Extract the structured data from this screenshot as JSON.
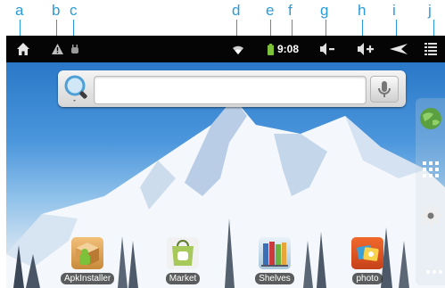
{
  "callouts": [
    "a",
    "b",
    "c",
    "d",
    "e",
    "f",
    "g",
    "h",
    "i",
    "j"
  ],
  "status_bar": {
    "time": "9:08",
    "icons": [
      "home-icon",
      "warning-icon",
      "usb-debug-icon",
      "wifi-icon",
      "battery-icon",
      "volume-down-icon",
      "volume-up-icon",
      "back-icon",
      "menu-icon"
    ]
  },
  "search": {
    "placeholder": ""
  },
  "side_panel": {
    "icons": [
      "browser-globe-icon",
      "app-drawer-grid-icon",
      "settings-gear-icon",
      "more-dots-icon"
    ]
  },
  "apps": [
    {
      "label": "ApkInstaller"
    },
    {
      "label": "Market"
    },
    {
      "label": "Shelves"
    },
    {
      "label": "photo"
    }
  ],
  "colors": {
    "callout": "#2a9bd6",
    "statusbar": "#050505",
    "accent_green": "#7dc13a"
  }
}
